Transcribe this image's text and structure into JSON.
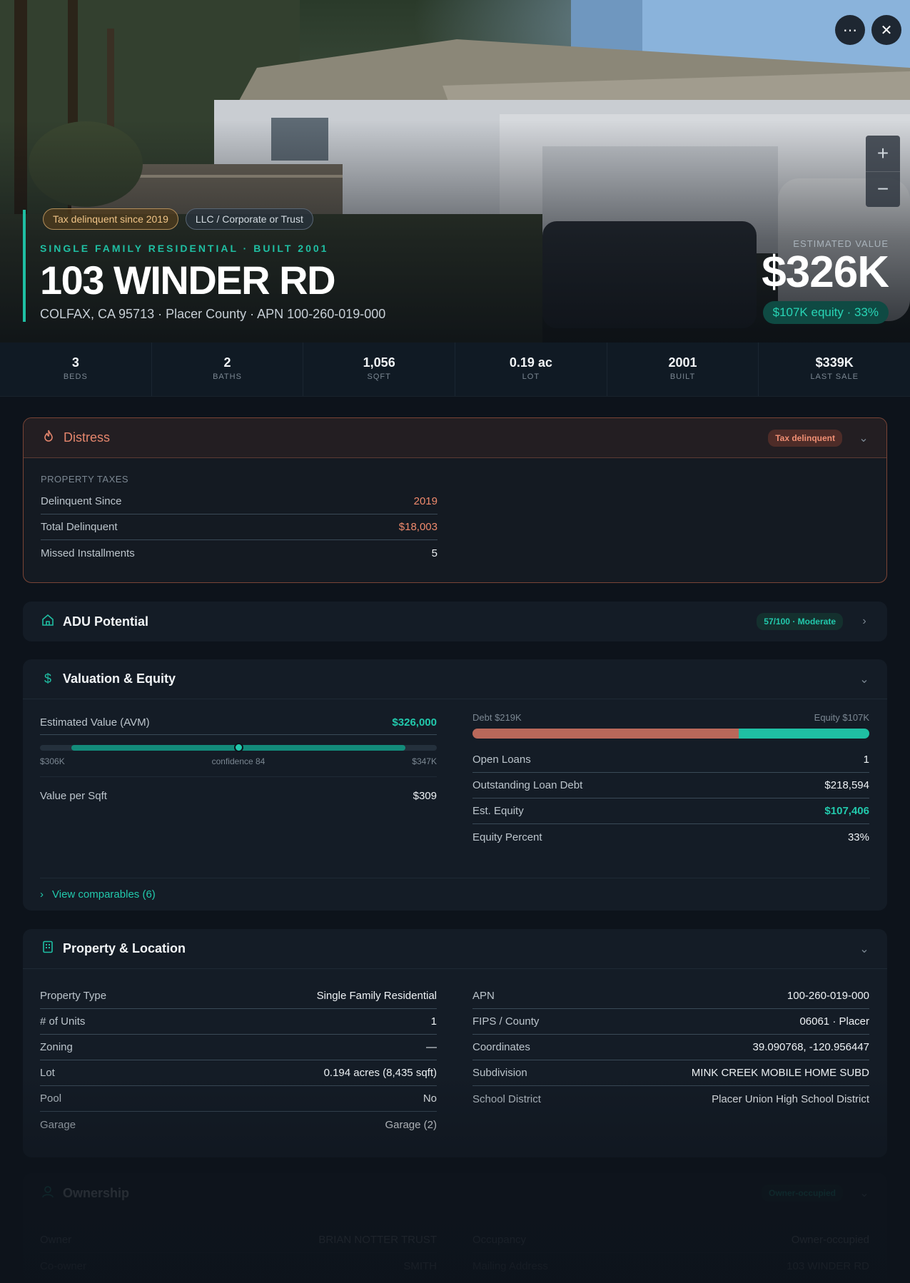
{
  "hero": {
    "chips": [
      "Tax delinquent since 2019",
      "LLC / Corporate or Trust"
    ],
    "meta": "SINGLE FAMILY RESIDENTIAL · BUILT 2001",
    "title": "103 WINDER RD",
    "subtitle": "COLFAX, CA 95713 · Placer County · APN 100-260-019-000",
    "value_label": "ESTIMATED VALUE",
    "value": "$326K",
    "equity_badge": "$107K equity · 33%",
    "more_icon": "more-horizontal-icon",
    "close_icon": "close-icon",
    "zoom_in": "+",
    "zoom_out": "−"
  },
  "stats": [
    {
      "value": "3",
      "label": "BEDS"
    },
    {
      "value": "2",
      "label": "BATHS"
    },
    {
      "value": "1,056",
      "label": "SQFT"
    },
    {
      "value": "0.19 ac",
      "label": "LOT"
    },
    {
      "value": "2001",
      "label": "BUILT"
    },
    {
      "value": "$339K",
      "label": "LAST SALE"
    }
  ],
  "distress": {
    "title": "Distress",
    "badge": "Tax delinquent",
    "section": "PROPERTY TAXES",
    "rows": [
      {
        "k": "Delinquent Since",
        "v": "2019"
      },
      {
        "k": "Total Delinquent",
        "v": "$18,003"
      },
      {
        "k": "Missed Installments",
        "v": "5"
      }
    ]
  },
  "adu": {
    "title": "ADU Potential",
    "badge": "57/100 · Moderate"
  },
  "valuation": {
    "title": "Valuation & Equity",
    "avm_label": "Estimated Value (AVM)",
    "avm_value": "$326,000",
    "range_low": "$306K",
    "confidence": "confidence 84",
    "range_high": "$347K",
    "range_fill_start": 0.08,
    "range_fill_end": 0.92,
    "range_point": 0.5,
    "value_per_sqft_label": "Value per Sqft",
    "value_per_sqft": "$309",
    "debt_label": "Debt $219K",
    "equity_label": "Equity $107K",
    "debt_fraction": 0.67,
    "debt_color": "#b9685a",
    "equity_color": "#1fbfa3",
    "rows": [
      {
        "k": "Open Loans",
        "v": "1"
      },
      {
        "k": "Outstanding Loan Debt",
        "v": "$218,594"
      },
      {
        "k": "Est. Equity",
        "v": "$107,406"
      },
      {
        "k": "Equity Percent",
        "v": "33%"
      }
    ],
    "view_comparables": "View comparables (6)"
  },
  "property": {
    "title": "Property & Location",
    "left": [
      {
        "k": "Property Type",
        "v": "Single Family Residential"
      },
      {
        "k": "# of Units",
        "v": "1"
      },
      {
        "k": "Zoning",
        "v": "—"
      },
      {
        "k": "Lot",
        "v": "0.194 acres (8,435 sqft)"
      },
      {
        "k": "Pool",
        "v": "No"
      },
      {
        "k": "Garage",
        "v": "Garage (2)"
      }
    ],
    "right": [
      {
        "k": "APN",
        "v": "100-260-019-000"
      },
      {
        "k": "FIPS / County",
        "v": "06061 · Placer"
      },
      {
        "k": "Coordinates",
        "v": "39.090768, -120.956447"
      },
      {
        "k": "Subdivision",
        "v": "MINK CREEK MOBILE HOME SUBD"
      },
      {
        "k": "School District",
        "v": "Placer Union High School District"
      }
    ]
  },
  "ownership": {
    "title": "Ownership",
    "badge": "Owner-occupied",
    "left": [
      {
        "k": "Owner",
        "v": "BRIAN NOTTER TRUST"
      },
      {
        "k": "Co-owner",
        "v": "SMITH"
      }
    ],
    "right": [
      {
        "k": "Occupancy",
        "v": "Owner-occupied"
      },
      {
        "k": "Mailing Address",
        "v": "103 WINDER RD"
      }
    ]
  }
}
